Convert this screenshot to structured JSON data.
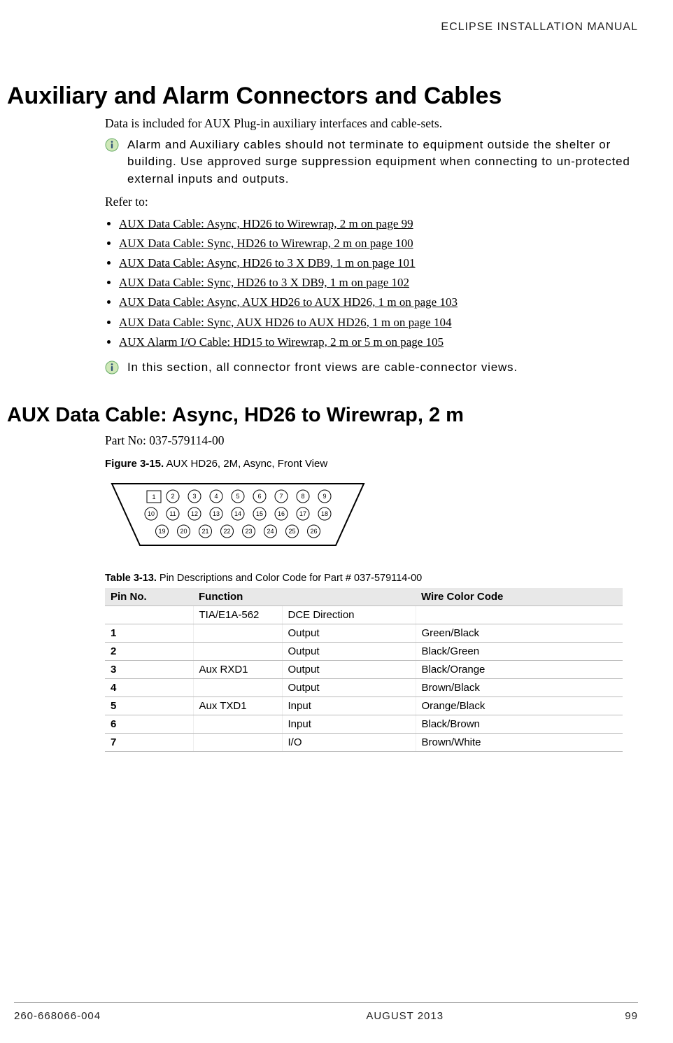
{
  "header": {
    "right": "ECLIPSE INSTALLATION MANUAL"
  },
  "h1": "Auxiliary and Alarm Connectors and Cables",
  "intro": "Data is included for AUX Plug-in auxiliary interfaces and cable-sets.",
  "note1": "Alarm and Auxiliary cables should not terminate to equipment outside the shelter or building. Use approved surge suppression equipment when connecting to un-protected external inputs and outputs.",
  "refer_label": "Refer to:",
  "refs": [
    "AUX Data Cable: Async, HD26 to Wirewrap, 2 m on page 99",
    "AUX Data Cable: Sync, HD26 to Wirewrap, 2 m on page 100",
    "AUX Data Cable: Async, HD26 to 3 X DB9, 1 m on page 101",
    "AUX Data Cable: Sync, HD26 to 3 X DB9, 1 m on page 102",
    "AUX Data Cable: Async, AUX HD26 to AUX HD26, 1 m on page 103",
    "AUX Data Cable: Sync, AUX HD26 to AUX HD26, 1 m on page 104",
    "AUX Alarm I/O Cable: HD15 to Wirewrap, 2 m or 5 m on page 105"
  ],
  "note2": "In this section, all connector front views are cable-connector views.",
  "h2": "AUX Data Cable: Async, HD26 to Wirewrap, 2 m",
  "part_no": "Part No: 037-579114-00",
  "figure": {
    "label": "Figure 3-15.",
    "caption": "AUX HD26, 2M, Async, Front View"
  },
  "connector_pins": [
    [
      1,
      2,
      3,
      4,
      5,
      6,
      7,
      8,
      9
    ],
    [
      10,
      11,
      12,
      13,
      14,
      15,
      16,
      17,
      18
    ],
    [
      19,
      20,
      21,
      22,
      23,
      24,
      25,
      26
    ]
  ],
  "table": {
    "label": "Table 3-13.",
    "caption": "Pin Descriptions and Color Code for Part # 037-579114-00",
    "headers": [
      "Pin No.",
      "Function",
      "Wire Color Code"
    ],
    "subheaders": [
      "",
      "TIA/E1A-562",
      "DCE Direction",
      ""
    ],
    "rows": [
      [
        "1",
        "",
        "Output",
        "Green/Black"
      ],
      [
        "2",
        "",
        "Output",
        "Black/Green"
      ],
      [
        "3",
        "Aux RXD1",
        "Output",
        "Black/Orange"
      ],
      [
        "4",
        "",
        "Output",
        "Brown/Black"
      ],
      [
        "5",
        "Aux TXD1",
        "Input",
        "Orange/Black"
      ],
      [
        "6",
        "",
        "Input",
        "Black/Brown"
      ],
      [
        "7",
        "",
        "I/O",
        "Brown/White"
      ]
    ]
  },
  "footer": {
    "left": "260-668066-004",
    "center": "AUGUST 2013",
    "right": "99"
  }
}
